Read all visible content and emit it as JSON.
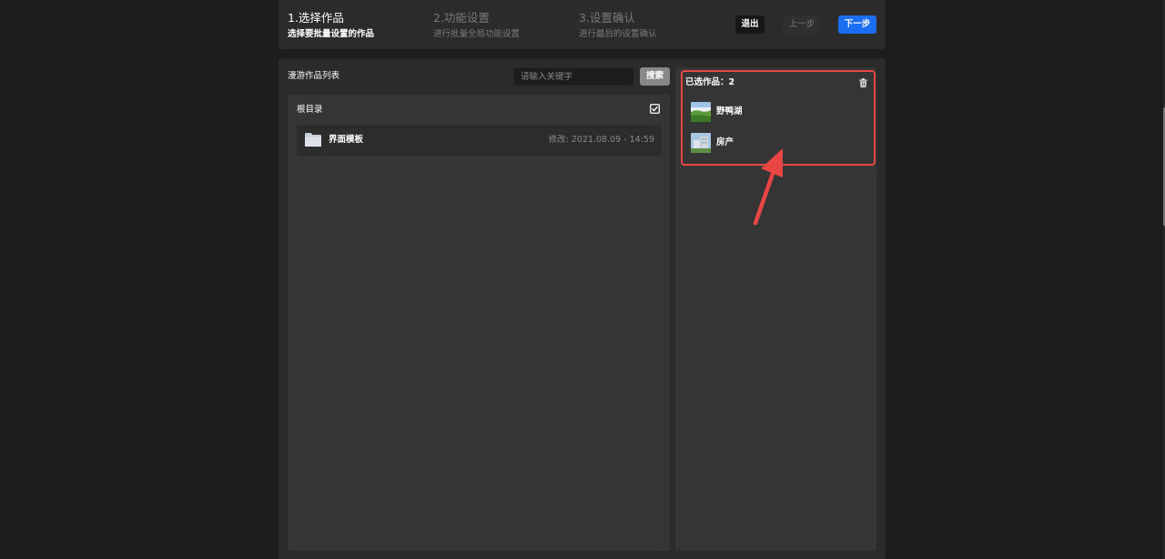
{
  "steps": [
    {
      "title": "1.选择作品",
      "subtitle": "选择要批量设置的作品"
    },
    {
      "title": "2.功能设置",
      "subtitle": "进行批量全局功能设置"
    },
    {
      "title": "3.设置确认",
      "subtitle": "进行最后的设置确认"
    }
  ],
  "buttons": {
    "exit": "退出",
    "prev": "上一步",
    "next": "下一步"
  },
  "list": {
    "title": "漫游作品列表",
    "search_placeholder": "请输入关键字",
    "search_button": "搜索",
    "folder_title": "根目录",
    "rows": [
      {
        "name": "界面模板",
        "modified": "修改: 2021.08.09 - 14:59"
      }
    ]
  },
  "selected": {
    "count_label": "已选作品：2",
    "items": [
      {
        "name": "野鸭湖",
        "icon": "landscape-thumbnail"
      },
      {
        "name": "房产",
        "icon": "building-thumbnail"
      }
    ]
  },
  "colors": {
    "accent": "#1c6ef2",
    "highlight": "#e84545",
    "background": "#1d1d1d",
    "panel": "#2b2b2b"
  }
}
